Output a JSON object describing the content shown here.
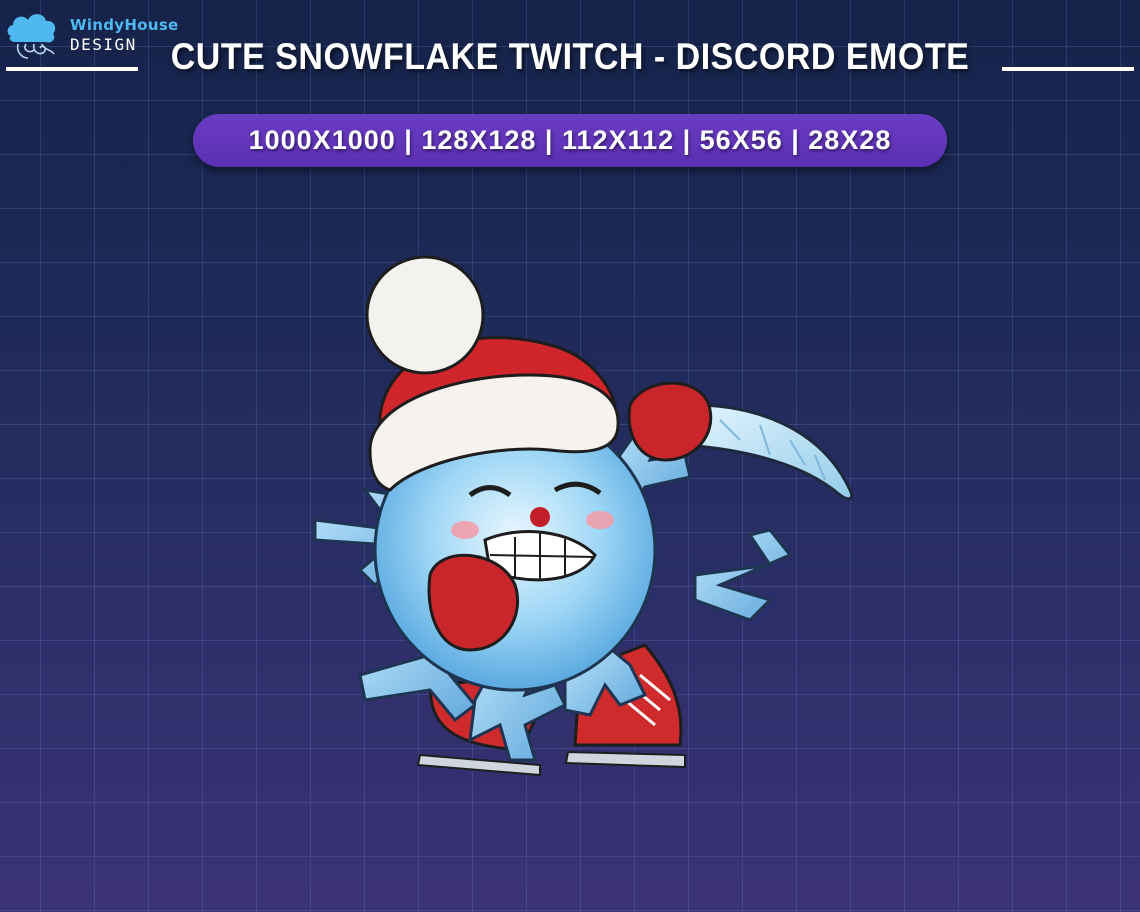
{
  "brand": {
    "name_top": "WindyHouse",
    "name_bottom": "DESIGN",
    "icon": "cloud-wind-icon"
  },
  "header": {
    "title": "CUTE SNOWFLAKE TWITCH - DISCORD EMOTE"
  },
  "sizes": {
    "text": "1000X1000 | 128X128 | 112X112 | 56X56 | 28X28"
  },
  "illustration": {
    "icon": "snowflake-santa-hat-knife-emote"
  },
  "colors": {
    "background_top": "#15234a",
    "background_bottom": "#3b3275",
    "pill": "#5b2fb3",
    "logo_blue": "#4fb8ef",
    "hat_red": "#d0262b",
    "snowflake_blue": "#7ec8f2"
  }
}
